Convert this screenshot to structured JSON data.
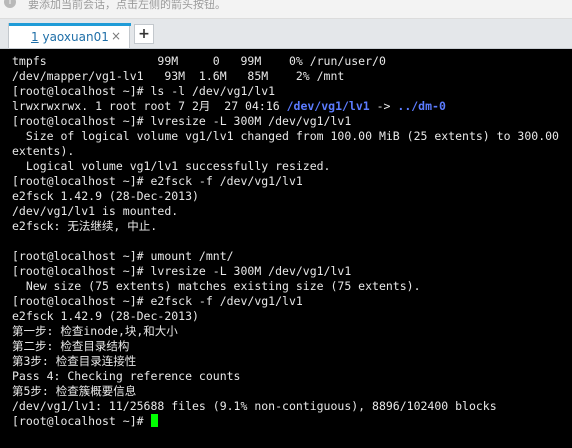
{
  "hint": {
    "icon": "info-icon",
    "text": "要添加当前会话，点击左侧的箭头按钮。"
  },
  "tabs": [
    {
      "index": "1",
      "label": "yaoxuan01",
      "close": "×",
      "active": true
    }
  ],
  "add_tab_label": "+",
  "colors": {
    "tab_accent": "#1f9bd7",
    "terminal_bg": "#000000",
    "terminal_fg": "#e8e8e8",
    "link_dir": "#5c7cff",
    "cursor": "#00ff00"
  },
  "terminal": {
    "lines": [
      "tmpfs                99M     0   99M    0% /run/user/0",
      "/dev/mapper/vg1-lv1   93M  1.6M   85M    2% /mnt",
      "[root@localhost ~]# ls -l /dev/vg1/lv1",
      "",
      "[root@localhost ~]# lvresize -L 300M /dev/vg1/lv1",
      "  Size of logical volume vg1/lv1 changed from 100.00 MiB (25 extents) to 300.00",
      "extents).",
      "  Logical volume vg1/lv1 successfully resized.",
      "[root@localhost ~]# e2fsck -f /dev/vg1/lv1",
      "e2fsck 1.42.9 (28-Dec-2013)",
      "/dev/vg1/lv1 is mounted.",
      "e2fsck: 无法继续, 中止.",
      "",
      "[root@localhost ~]# umount /mnt/",
      "[root@localhost ~]# lvresize -L 300M /dev/vg1/lv1",
      "  New size (75 extents) matches existing size (75 extents).",
      "[root@localhost ~]# e2fsck -f /dev/vg1/lv1",
      "e2fsck 1.42.9 (28-Dec-2013)",
      "第一步: 检查inode,块,和大小",
      "第二步: 检查目录结构",
      "第3步: 检查目录连接性",
      "Pass 4: Checking reference counts",
      "第5步: 检查簇概要信息",
      "/dev/vg1/lv1: 11/25688 files (9.1% non-contiguous), 8896/102400 blocks"
    ],
    "symlink": {
      "prefix": "lrwxrwxrwx. 1 root root 7 2月  27 04:16 ",
      "path": "/dev/vg1/lv1",
      "arrow": " -> ",
      "target": "../dm-0"
    },
    "prompt": "[root@localhost ~]# "
  }
}
